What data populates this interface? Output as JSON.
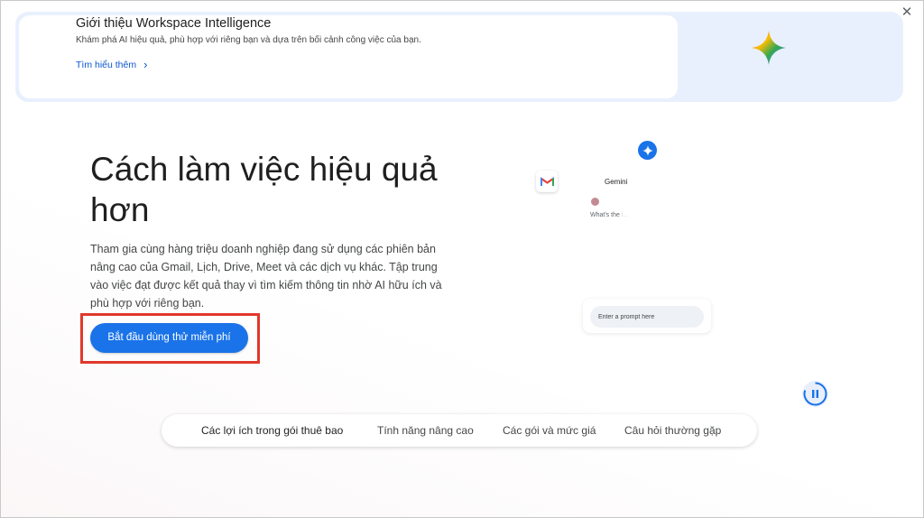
{
  "banner": {
    "title": "Giới thiệu Workspace Intelligence",
    "subtitle": "Khám phá AI hiệu quả, phù hợp với riêng bạn và dựa trên bối cảnh công việc của bạn.",
    "link_label": "Tìm hiểu thêm",
    "link_icon": "chevron-right-icon",
    "spark_icon": "gemini-spark-icon",
    "close_icon": "close-icon"
  },
  "hero": {
    "title": "Cách làm việc hiệu quả hơn",
    "description": "Tham gia cùng hàng triệu doanh nghiệp đang sử dụng các phiên bản nâng cao của Gmail, Lịch, Drive, Meet và các dịch vụ khác. Tập trung vào việc đạt được kết quả thay vì tìm kiếm thông tin nhờ AI hữu ích và phù hợp với riêng bạn.",
    "cta_label": "Bắt đầu dùng thử miễn phí"
  },
  "illustration": {
    "panel_title": "Gemini",
    "question_visible": "What's the",
    "question_faded": "l...",
    "prompt_placeholder": "Enter a prompt here",
    "gmail_icon": "gmail-icon",
    "star_icon": "sparkle-icon",
    "pause_icon": "pause-icon"
  },
  "tabs": [
    {
      "label": "Các lợi ích trong gói thuê bao",
      "active": true
    },
    {
      "label": "Tính năng nâng cao",
      "active": false
    },
    {
      "label": "Các gói và mức giá",
      "active": false
    },
    {
      "label": "Câu hỏi thường gặp",
      "active": false
    }
  ],
  "colors": {
    "accent": "#1a73e8",
    "highlight_box": "#e0392b",
    "banner_bg": "#e9f0fd"
  }
}
